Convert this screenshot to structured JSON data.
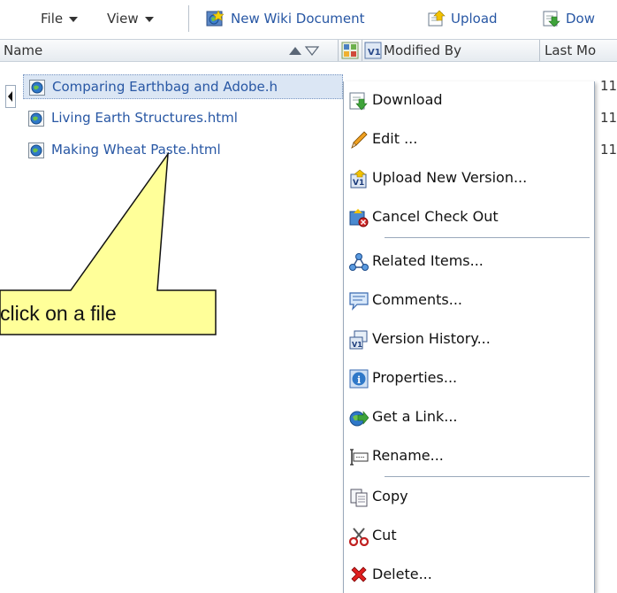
{
  "toolbar": {
    "file": "File",
    "view": "View",
    "new_wiki": "New Wiki Document",
    "upload": "Upload",
    "download_partial": "Dow"
  },
  "header": {
    "name": "Name",
    "modified_by": "Modified By",
    "last_modified_partial": "Last Mo"
  },
  "files": [
    {
      "name": "Comparing Earthbag and Adobe.h",
      "date_partial": "11"
    },
    {
      "name": "Living Earth Structures.html",
      "date_partial": "11"
    },
    {
      "name": "Making Wheat Paste.html",
      "date_partial": "11"
    }
  ],
  "menu": [
    {
      "label": "Download",
      "icon": "download-icon"
    },
    {
      "label": "Edit ...",
      "icon": "pencil-icon"
    },
    {
      "label": "Upload New Version...",
      "icon": "upload-version-icon"
    },
    {
      "label": "Cancel Check Out",
      "icon": "cancel-checkout-icon"
    },
    {
      "label": "Related Items...",
      "icon": "related-items-icon"
    },
    {
      "label": "Comments...",
      "icon": "comments-icon"
    },
    {
      "label": "Version History...",
      "icon": "version-history-icon"
    },
    {
      "label": "Properties...",
      "icon": "properties-icon"
    },
    {
      "label": "Get a Link...",
      "icon": "link-icon"
    },
    {
      "label": "Rename...",
      "icon": "rename-icon"
    },
    {
      "label": "Copy",
      "icon": "copy-icon"
    },
    {
      "label": "Cut",
      "icon": "cut-icon"
    },
    {
      "label": "Delete...",
      "icon": "delete-icon"
    }
  ],
  "callout": {
    "text": "click on a file"
  },
  "colors": {
    "link": "#2857a4",
    "callout_fill": "#ffff99",
    "selection": "#dbe6f4"
  }
}
